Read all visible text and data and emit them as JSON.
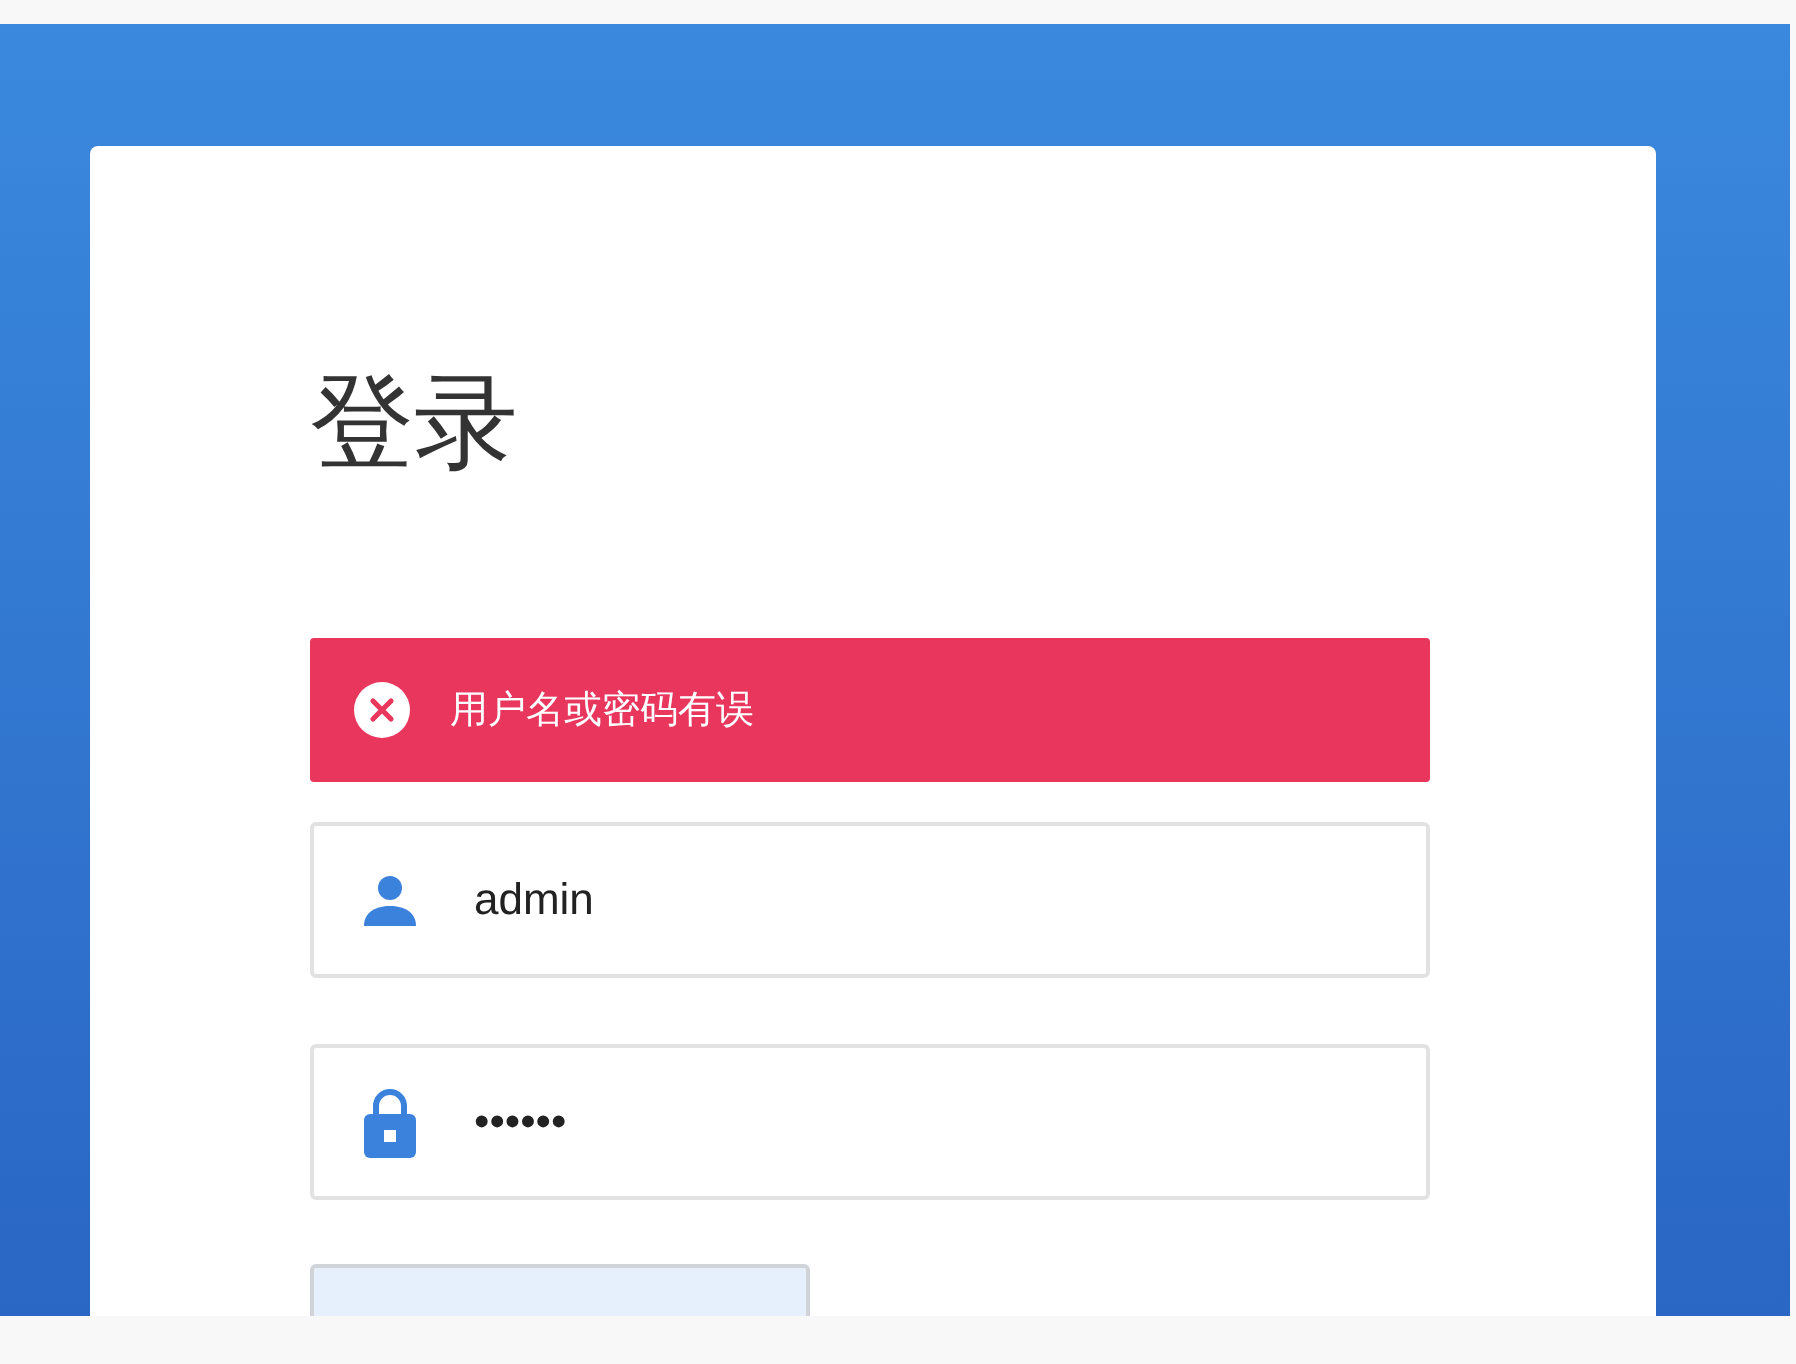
{
  "login": {
    "title": "登录",
    "error": {
      "message": "用户名或密码有误"
    },
    "fields": [
      {
        "kind": "user",
        "value": "admin"
      },
      {
        "kind": "password",
        "value": "••••••"
      }
    ]
  }
}
